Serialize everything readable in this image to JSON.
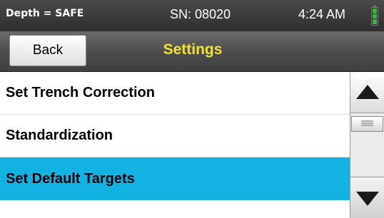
{
  "status": {
    "depth": "Depth = SAFE",
    "serial": "SN: 08020",
    "time": "4:24 AM"
  },
  "header": {
    "back_label": "Back",
    "title": "Settings"
  },
  "menu": {
    "items": [
      {
        "label": "Set Trench Correction"
      },
      {
        "label": "Standardization"
      },
      {
        "label": "Set Default Targets"
      }
    ],
    "selected_index": 2
  },
  "colors": {
    "title": "#f2e233",
    "selection": "#12b3e3",
    "battery": "#3fb53f"
  },
  "icons": {
    "battery": "battery-icon",
    "scroll_up": "triangle-up-icon",
    "scroll_down": "triangle-down-icon",
    "scroll_thumb": "grip-lines-icon"
  }
}
